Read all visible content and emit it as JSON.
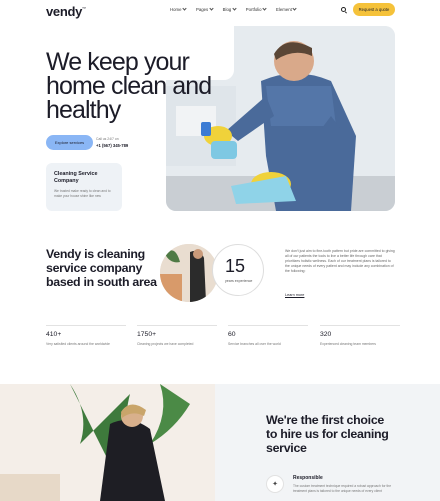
{
  "header": {
    "logo": "vendy",
    "logo_mark": "™",
    "nav": [
      {
        "label": "Home"
      },
      {
        "label": "Pages"
      },
      {
        "label": "Blog"
      },
      {
        "label": "Portfolio"
      },
      {
        "label": "Element"
      }
    ],
    "quote_button": "Request a quote"
  },
  "hero": {
    "title": "We keep your home clean and healthy",
    "cta": "Explore services",
    "call_label": "Call us 24/7 on",
    "phone": "+1 (567) 345-789",
    "card_title": "Cleaning Service Company",
    "card_desc": "We trusted make ready to clean and to make your house shine like new"
  },
  "about": {
    "title": "Vendy is cleaning service company based in south area",
    "years": "15",
    "years_label": "years experience",
    "text": "We don't just aim to fine-tooth pattern but pride are committed to giving all of our patients the tools to live a better life through care that prioritizes holistic wellness. Each of our treatment plans is tailored to the unique needs of every patient and may include any combination of the following:",
    "link": "Learn more"
  },
  "stats": [
    {
      "num": "410+",
      "label": "Very satisfied clients around the worldwide"
    },
    {
      "num": "1750+",
      "label": "Cleaning projects we have completed"
    },
    {
      "num": "60",
      "label": "Service branches all over the world"
    },
    {
      "num": "320",
      "label": "Experienced cleaning team members"
    }
  ],
  "choice": {
    "title": "We're the first choice to hire us for cleaning service",
    "feature_title": "Responsible",
    "feature_desc": "The custom treatment technique required a robust approach for the treatment plans is tailored to the unique needs of every client"
  },
  "colors": {
    "accent_yellow": "#f5c23a",
    "accent_blue": "#8ab6f5",
    "text": "#1c1c28"
  }
}
